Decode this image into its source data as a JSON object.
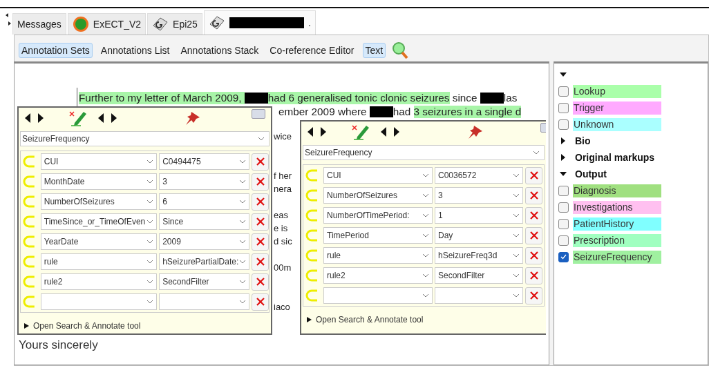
{
  "tabs": [
    {
      "label": "Messages",
      "kind": "plain",
      "redacted": false,
      "selected": false
    },
    {
      "label": "ExECT_V2",
      "kind": "app",
      "redacted": false,
      "selected": false
    },
    {
      "label": "Epi25",
      "kind": "document",
      "redacted": false,
      "selected": false
    },
    {
      "label": ".",
      "kind": "document",
      "redacted": true,
      "selected": true
    }
  ],
  "toolbar": [
    {
      "label": "Annotation Sets",
      "selected": true
    },
    {
      "label": "Annotations List",
      "selected": false
    },
    {
      "label": "Annotations Stack",
      "selected": false
    },
    {
      "label": "Co-reference Editor",
      "selected": false
    },
    {
      "label": "Text",
      "selected": true
    }
  ],
  "document": {
    "lines": [
      [
        {
          "text": "Further to my letter of March 2009, ",
          "highlighted": true
        },
        {
          "kind": "redacted"
        },
        {
          "text": "had 6 generalised tonic clonic seizures",
          "highlighted": true
        },
        {
          "text": " since ",
          "highlighted": false
        },
        {
          "kind": "redacted"
        },
        {
          "text": "las",
          "highlighted": false
        }
      ],
      [
        {
          "text": "ember 2009 where ",
          "highlighted": false
        },
        {
          "kind": "redacted"
        },
        {
          "text": "had ",
          "highlighted": false
        },
        {
          "text": "3 seizures in a single d",
          "highlighted": true
        }
      ]
    ],
    "fragments": [
      "wice",
      "f her",
      "nera",
      "eas",
      "e is",
      "d sic",
      "00m",
      "iaco"
    ],
    "closing": "Yours sincerely"
  },
  "editors": [
    {
      "type": "SeizureFrequency",
      "features": [
        {
          "kind": "filled",
          "name": "CUI",
          "value": "C0494475"
        },
        {
          "kind": "filled",
          "name": "MonthDate",
          "value": "3"
        },
        {
          "kind": "filled",
          "name": "NumberOfSeizures",
          "value": "6"
        },
        {
          "kind": "filled",
          "name": "TimeSince_or_TimeOfEven",
          "value": "Since"
        },
        {
          "kind": "filled",
          "name": "YearDate",
          "value": "2009"
        },
        {
          "kind": "filled",
          "name": "rule",
          "value": "hSeizurePartialDate:"
        },
        {
          "kind": "filled",
          "name": "rule2",
          "value": "SecondFilter"
        },
        {
          "kind": "blank"
        }
      ],
      "footer": "Open Search & Annotate tool"
    },
    {
      "type": "SeizureFrequency",
      "features": [
        {
          "kind": "filled",
          "name": "CUI",
          "value": "C0036572"
        },
        {
          "kind": "filled",
          "name": "NumberOfSeizures",
          "value": "3"
        },
        {
          "kind": "filled",
          "name": "NumberOfTimePeriod:",
          "value": "1"
        },
        {
          "kind": "filled",
          "name": "TimePeriod",
          "value": "Day"
        },
        {
          "kind": "filled",
          "name": "rule",
          "value": "hSeizureFreq3d"
        },
        {
          "kind": "filled",
          "name": "rule2",
          "value": "SecondFilter"
        },
        {
          "kind": "blank"
        }
      ],
      "footer": "Open Search & Annotate tool"
    }
  ],
  "annotation_sets": [
    {
      "expanded": true,
      "types": [
        {
          "name": "Lookup",
          "checked": false,
          "color": "#aaffaa"
        },
        {
          "name": "Trigger",
          "checked": false,
          "color": "#ffaaff"
        },
        {
          "name": "Unknown",
          "checked": false,
          "color": "#aaffff"
        }
      ]
    },
    {
      "name": "Bio",
      "expanded": false
    },
    {
      "name": "Original markups",
      "expanded": false
    },
    {
      "name": "Output",
      "expanded": true,
      "types": [
        {
          "name": "Diagnosis",
          "checked": false,
          "color": "#a0e080"
        },
        {
          "name": "Investigations",
          "checked": false,
          "color": "#ffc0f0"
        },
        {
          "name": "PatientHistory",
          "checked": false,
          "color": "#80ffff"
        },
        {
          "name": "Prescription",
          "checked": false,
          "color": "#a0ffc0"
        },
        {
          "name": "SeizureFrequency",
          "checked": true,
          "color": "#a0f0a0"
        }
      ]
    }
  ]
}
